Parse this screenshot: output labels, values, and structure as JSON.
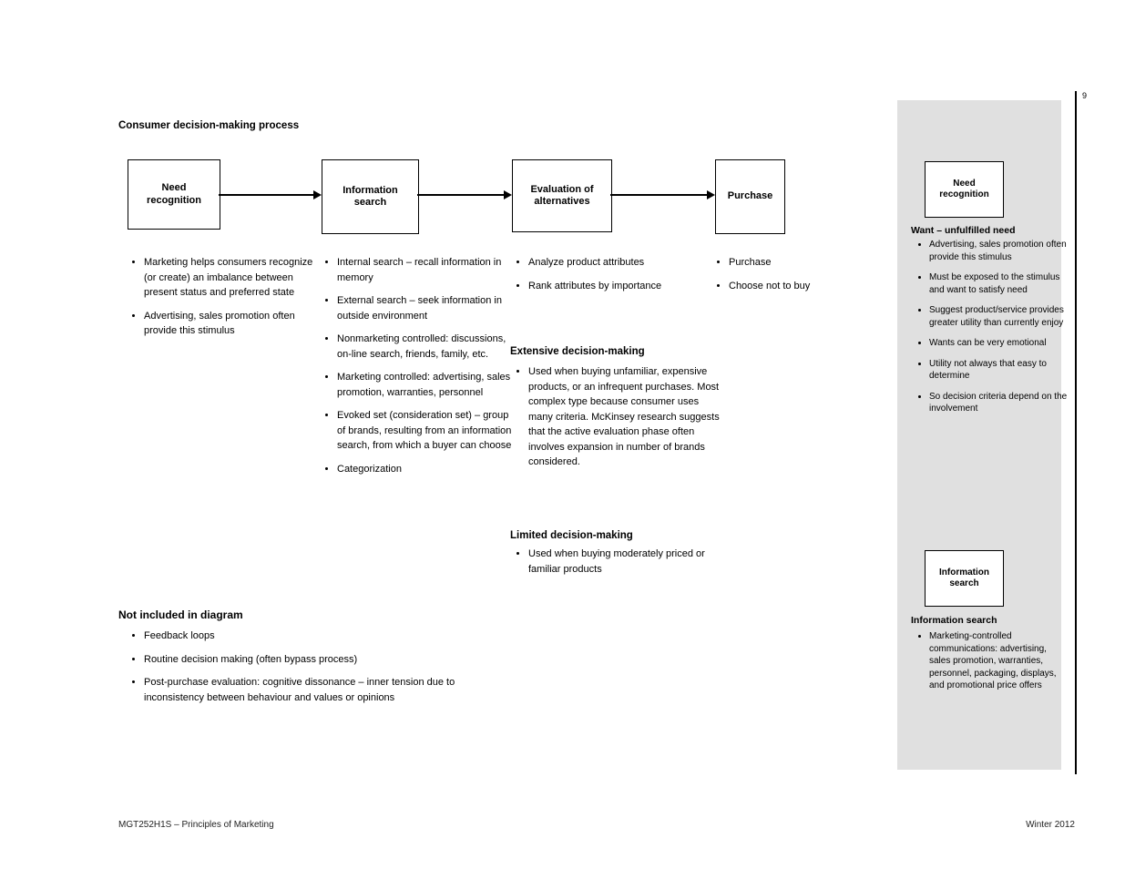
{
  "header": {
    "title": "Consumer decision-making process",
    "page_number": "9"
  },
  "flow": {
    "boxes": [
      {
        "label": "Need\nrecognition"
      },
      {
        "label": "Information\nsearch"
      },
      {
        "label": "Evaluation of\nalternatives"
      },
      {
        "label": "Purchase"
      }
    ]
  },
  "columns": {
    "col1": {
      "bullets": [
        "Marketing helps consumers recognize (or create) an imbalance between present status and preferred state",
        "Advertising, sales promotion often provide this stimulus"
      ]
    },
    "col2": {
      "bullets": [
        "Internal search – recall information in memory",
        "External search – seek information in outside environment",
        "Nonmarketing controlled: discussions, on-line search, friends, family, etc.",
        "Marketing controlled: advertising, sales promotion, warranties, personnel",
        "Evoked set (consideration set) – group of brands, resulting from an information search, from which a buyer can choose",
        "Categorization"
      ]
    },
    "col3": {
      "bullets_a": [
        "Analyze product attributes",
        "Rank attributes by importance"
      ],
      "sub1_label": "Extensive decision-making",
      "bullets_b": [
        "Used when buying unfamiliar, expensive products, or an infrequent purchases. Most complex type because consumer uses many criteria. McKinsey research suggests that the active evaluation phase often involves expansion in number of brands considered."
      ],
      "sub2_label": "Limited decision-making",
      "bullets_c": [
        "Used when buying moderately priced or familiar products"
      ]
    },
    "col4": {
      "bullets": [
        "Purchase",
        "Choose not to buy"
      ]
    }
  },
  "lower": {
    "heading": "Not included in diagram",
    "bullets": [
      "Feedback loops",
      "Routine decision making (often bypass process)",
      "Post-purchase evaluation: cognitive dissonance – inner tension due to inconsistency between behaviour and values or opinions"
    ]
  },
  "sidebar": {
    "block1": {
      "box_label": "Need\nrecognition",
      "heading": "Want – unfulfilled need",
      "bullets": [
        "Advertising, sales promotion often provide this stimulus",
        "Must be exposed to the stimulus and want to satisfy need",
        "Suggest product/service provides greater utility than currently enjoy",
        "Wants can be very emotional",
        "Utility not always that easy to determine",
        "So decision criteria depend on the involvement"
      ]
    },
    "block2": {
      "box_label": "Information\nsearch",
      "heading": "Information search",
      "bullets": [
        "Marketing-controlled communications: advertising, sales promotion, warranties, personnel, packaging, displays, and promotional price offers"
      ]
    }
  },
  "footer": {
    "course": "MGT252H1S – Principles of Marketing",
    "term": "Winter 2012"
  }
}
